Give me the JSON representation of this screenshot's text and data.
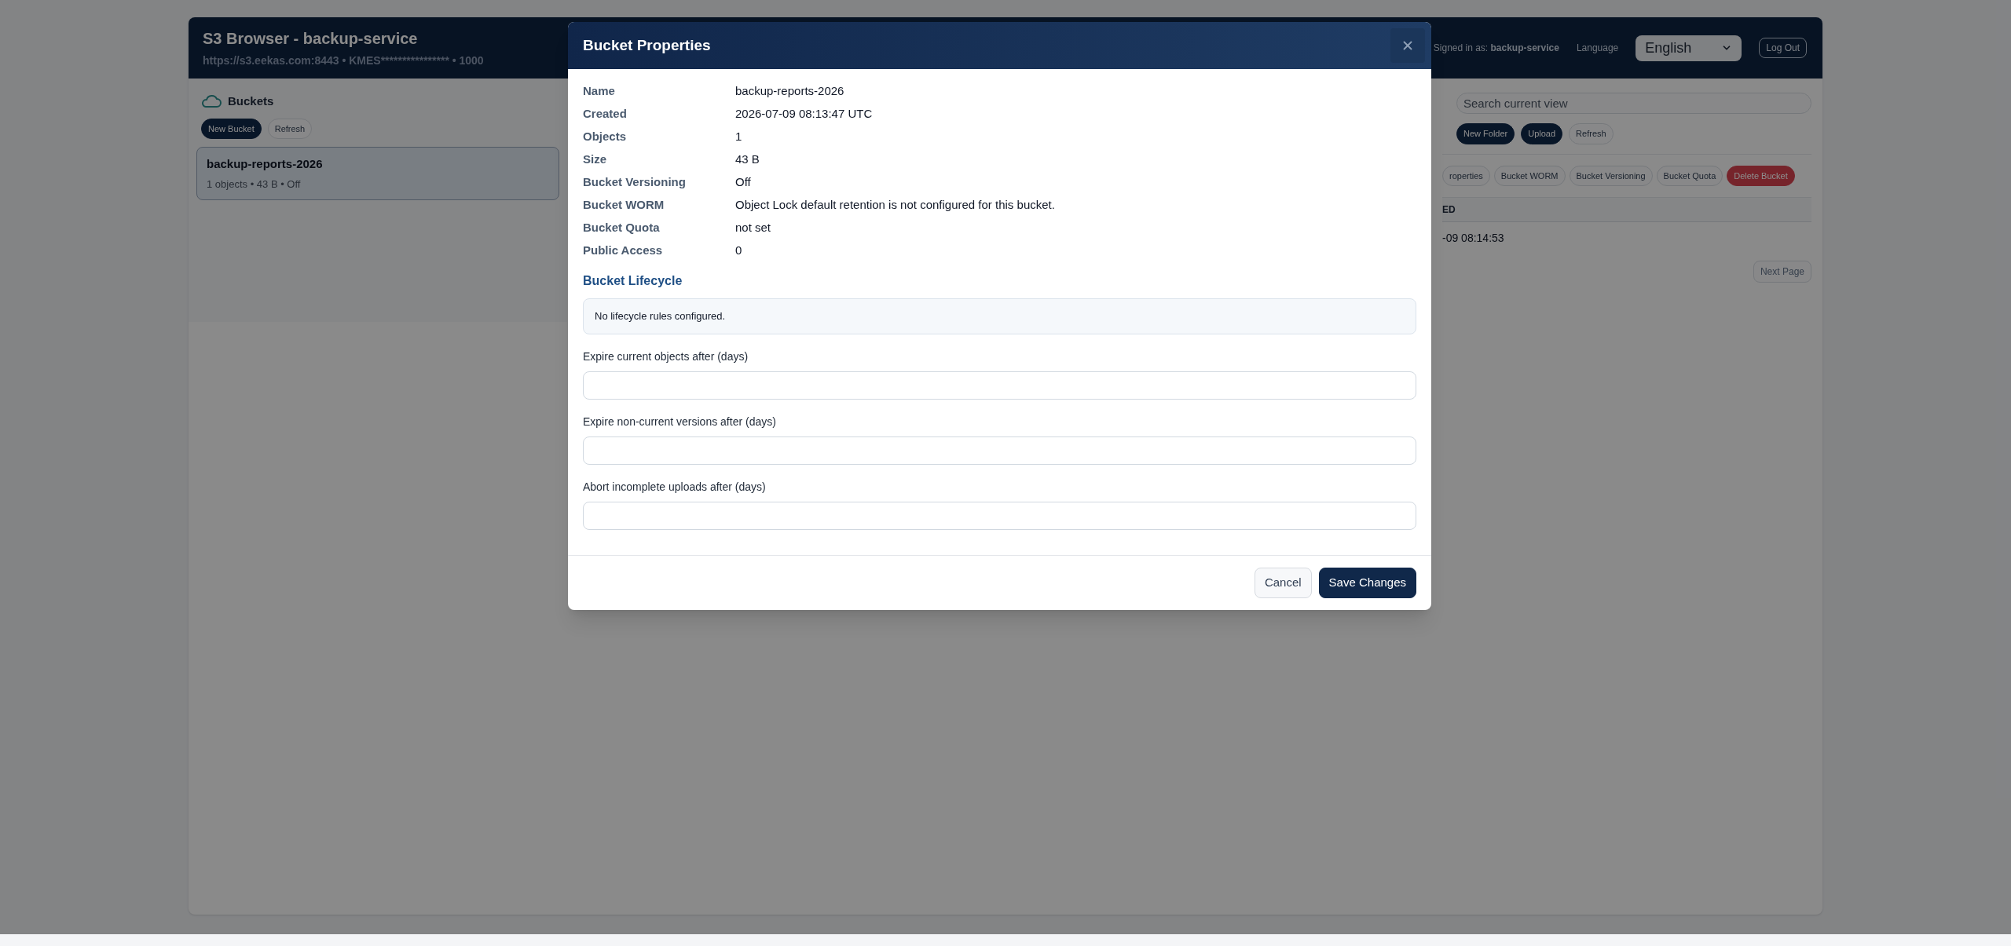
{
  "app": {
    "title": "S3 Browser - backup-service",
    "connection": "https://s3.eekas.com:8443 • KMES**************** • 1000",
    "signed_in": "Signed in as: **backup-service**",
    "language_label": "Language",
    "language": "English",
    "logout": "Log Out"
  },
  "buckets": {
    "title": "Buckets",
    "buttons": [
      {
        "label": "New Bucket",
        "kind": "primary"
      },
      {
        "label": "Refresh",
        "kind": "secondary"
      }
    ],
    "items": [
      {
        "name": "backup-reports-2026",
        "meta": "1 objects • 43 B • Off",
        "selected": true
      }
    ]
  },
  "objects": {
    "search": {
      "placeholder": "Search current view"
    },
    "buttons": [
      {
        "label": "New Folder",
        "kind": "primary"
      },
      {
        "label": "Upload",
        "kind": "primary"
      },
      {
        "label": "Refresh",
        "kind": "secondary"
      }
    ],
    "bucket_actions": [
      {
        "label": "roperties",
        "kind": "secondary"
      },
      {
        "label": "Bucket WORM",
        "kind": "secondary"
      },
      {
        "label": "Bucket Versioning",
        "kind": "secondary"
      },
      {
        "label": "Bucket Quota",
        "kind": "secondary"
      },
      {
        "label": "Delete Bucket",
        "kind": "danger"
      }
    ],
    "columns": [
      "ED"
    ],
    "rows": [
      [
        "-09 08:14:53"
      ]
    ],
    "next_page": "Next Page"
  },
  "dialog": {
    "title": "Bucket Properties",
    "properties": [
      {
        "label": "Name",
        "value": "backup-reports-2026"
      },
      {
        "label": "Created",
        "value": "2026-07-09 08:13:47 UTC"
      },
      {
        "label": "Objects",
        "value": "1"
      },
      {
        "label": "Size",
        "value": "43 B"
      },
      {
        "label": "Bucket Versioning",
        "value": "Off"
      },
      {
        "label": "Bucket WORM",
        "value": "Object Lock default retention is not configured for this bucket."
      },
      {
        "label": "Bucket Quota",
        "value": "not set"
      },
      {
        "label": "Public Access",
        "value": "0"
      }
    ],
    "lifecycle": {
      "title": "Bucket Lifecycle",
      "message": "No lifecycle rules configured.",
      "fields": [
        {
          "label": "Expire current objects after (days)"
        },
        {
          "label": "Expire non-current versions after (days)"
        },
        {
          "label": "Abort incomplete uploads after (days)"
        }
      ]
    },
    "buttons": [
      {
        "label": "Cancel",
        "kind": "secondary"
      },
      {
        "label": "Save Changes",
        "kind": "primary"
      }
    ]
  }
}
